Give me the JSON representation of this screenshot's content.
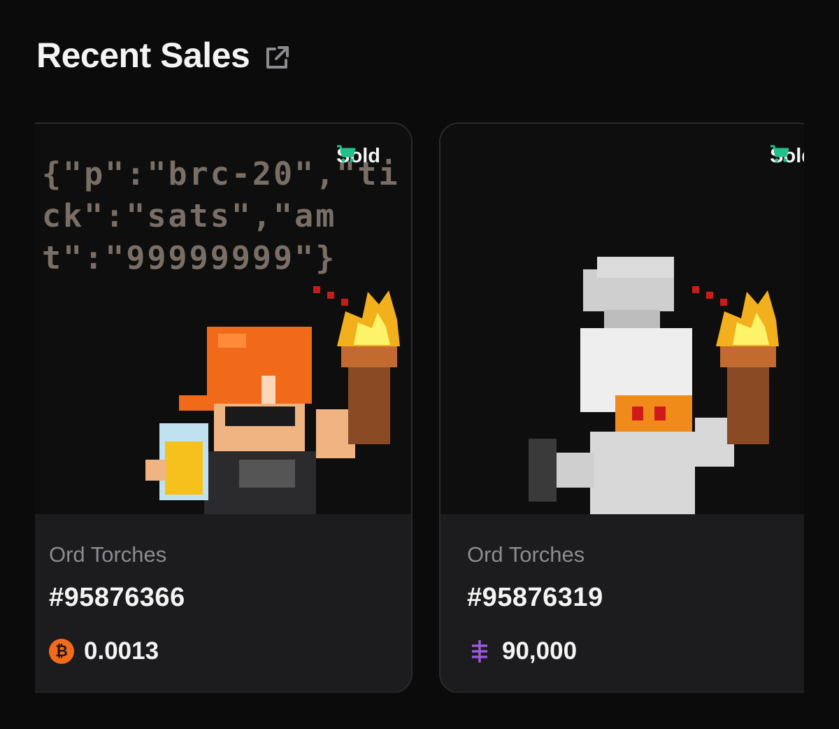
{
  "section": {
    "title": "Recent Sales",
    "external_link_icon": "external-link-icon"
  },
  "cards": [
    {
      "inscription_text": "{\"p\":\"brc-20\",\"tick\":\"sats\",\"amt\":\"99999999\"}",
      "status": "Sold",
      "status_icon": "cart-icon",
      "collection": "Ord Torches",
      "number": "#95876366",
      "currency_icon": "bitcoin-icon",
      "currency_color": "#f36b1c",
      "price": "0.0013"
    },
    {
      "status": "Sold",
      "status_icon": "cart-icon",
      "collection": "Ord Torches",
      "number": "#95876319",
      "currency_icon": "rune-icon",
      "currency_color": "#9b59d6",
      "price": "90,000"
    }
  ],
  "colors": {
    "background": "#0b0b0c",
    "card_info_bg": "#1c1c1e",
    "sold_icon": "#22c08a",
    "muted_text": "#8c8c91"
  }
}
